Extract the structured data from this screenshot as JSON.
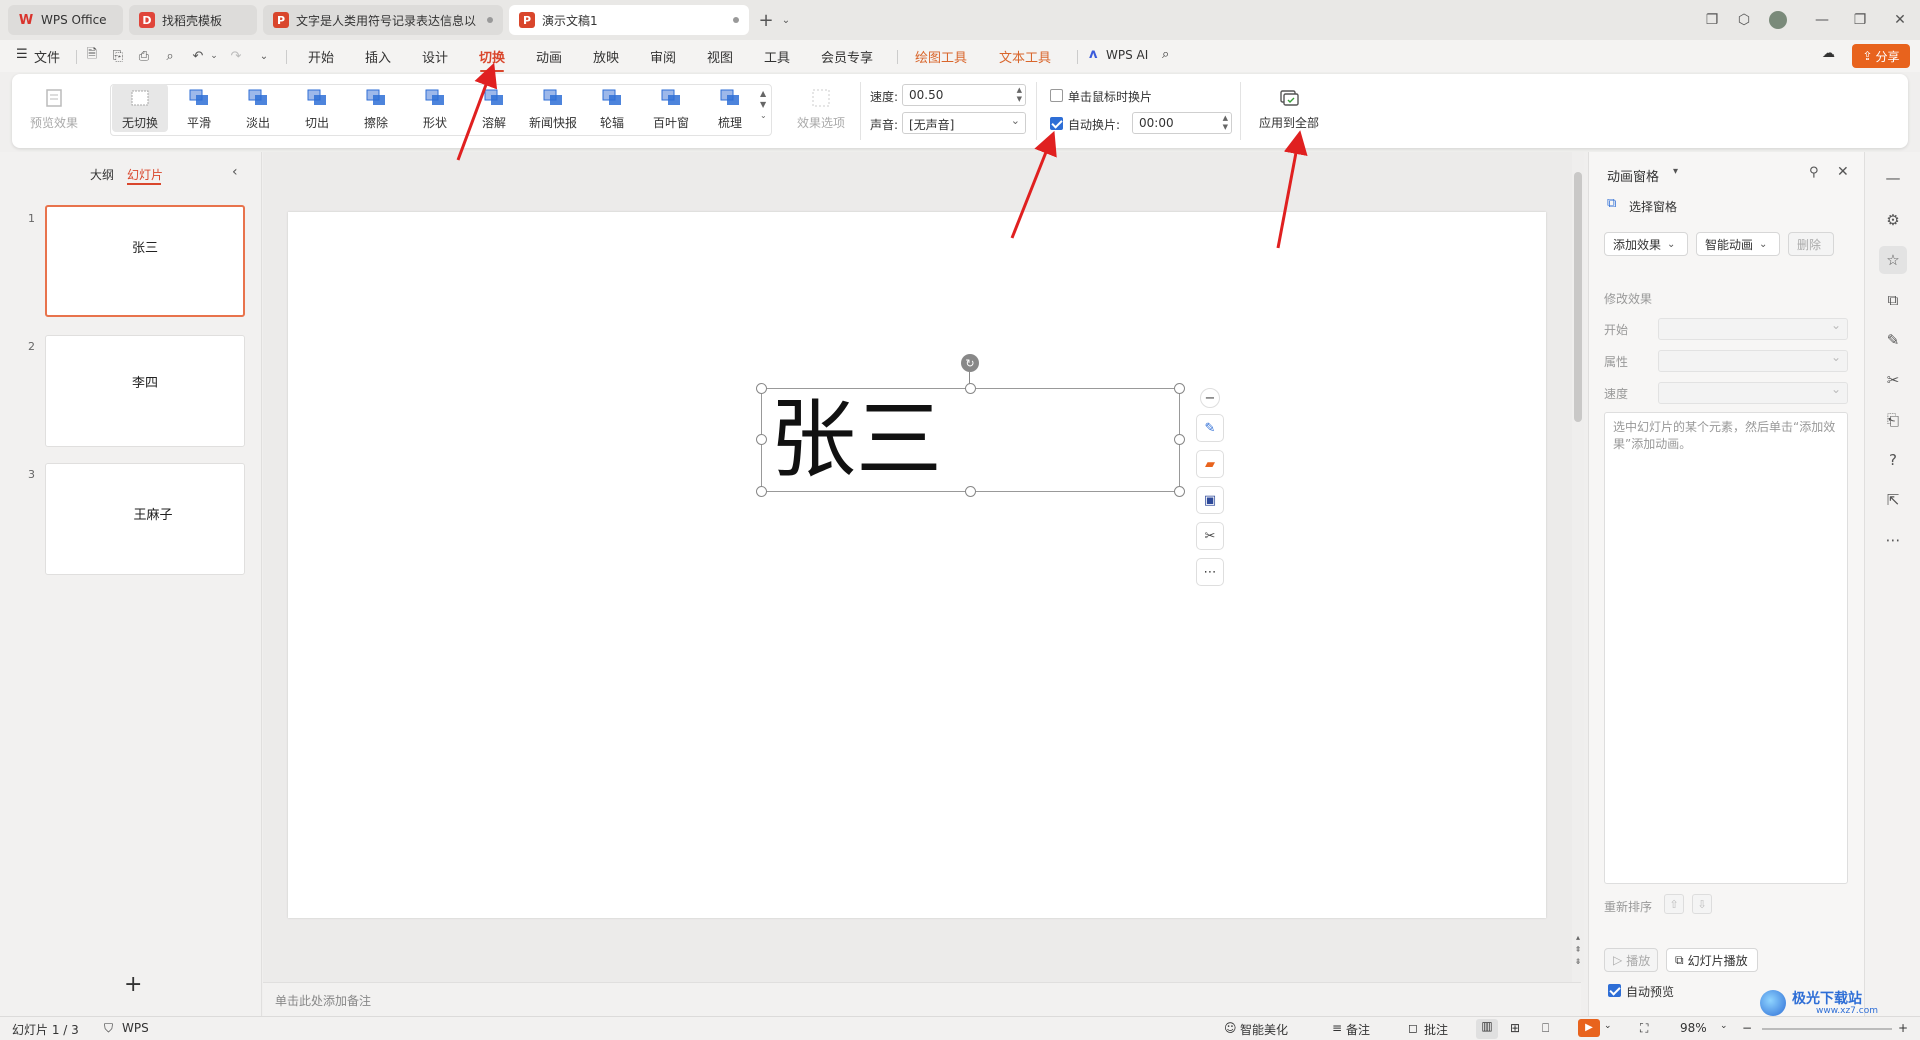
{
  "app": {
    "tabs": [
      {
        "label": "WPS Office",
        "icon": "wps-logo-icon"
      },
      {
        "label": "找稻壳模板",
        "icon": "docer-icon"
      },
      {
        "label": "文字是人类用符号记录表达信息以",
        "icon": "ppt-icon"
      },
      {
        "label": "演示文稿1",
        "icon": "ppt-icon"
      }
    ],
    "new_tab": "+"
  },
  "menubar": {
    "file": "文件",
    "items": [
      "开始",
      "插入",
      "设计",
      "切换",
      "动画",
      "放映",
      "审阅",
      "视图",
      "工具",
      "会员专享",
      "绘图工具",
      "文本工具"
    ],
    "active": "切换",
    "wps_ai": "WPS AI",
    "share": "分享"
  },
  "ribbon": {
    "preview": "预览效果",
    "transitions": [
      "无切换",
      "平滑",
      "淡出",
      "切出",
      "擦除",
      "形状",
      "溶解",
      "新闻快报",
      "轮辐",
      "百叶窗",
      "梳理"
    ],
    "selected_transition": "无切换",
    "effect_options": "效果选项",
    "speed_label": "速度:",
    "speed_value": "00.50",
    "sound_label": "声音:",
    "sound_value": "[无声音]",
    "on_click_label": "单击鼠标时换片",
    "on_click_checked": false,
    "auto_label": "自动换片:",
    "auto_checked": true,
    "auto_time": "00:00",
    "apply_all": "应用到全部"
  },
  "leftpanel": {
    "tab_outline": "大纲",
    "tab_slides": "幻灯片",
    "slides": [
      {
        "num": "1",
        "title": "张三"
      },
      {
        "num": "2",
        "title": "李四"
      },
      {
        "num": "3",
        "title": "王麻子"
      }
    ],
    "add": "+"
  },
  "slide": {
    "text": "张三"
  },
  "notes": {
    "placeholder": "单击此处添加备注"
  },
  "anim_panel": {
    "title": "动画窗格",
    "select_pane": "选择窗格",
    "add_effect": "添加效果",
    "smart_anim": "智能动画",
    "delete": "删除",
    "modify_effect": "修改效果",
    "start_label": "开始",
    "property_label": "属性",
    "speed_label": "速度",
    "hint": "选中幻灯片的某个元素，然后单击“添加效果”添加动画。",
    "reorder": "重新排序",
    "play": "播放",
    "slideshow": "幻灯片播放",
    "auto_preview": "自动预览",
    "auto_preview_checked": true
  },
  "statusbar": {
    "slide_count": "幻灯片 1 / 3",
    "theme": "WPS",
    "beautify": "智能美化",
    "notes": "备注",
    "comments": "批注",
    "zoom": "98%"
  },
  "watermark": {
    "text": "极光下载站",
    "url": "www.xz7.com"
  },
  "colors": {
    "accent": "#d9462c",
    "share_bg": "#e8631d",
    "checkbox": "#2e6ed6",
    "annotation_arrow": "#e02020"
  }
}
